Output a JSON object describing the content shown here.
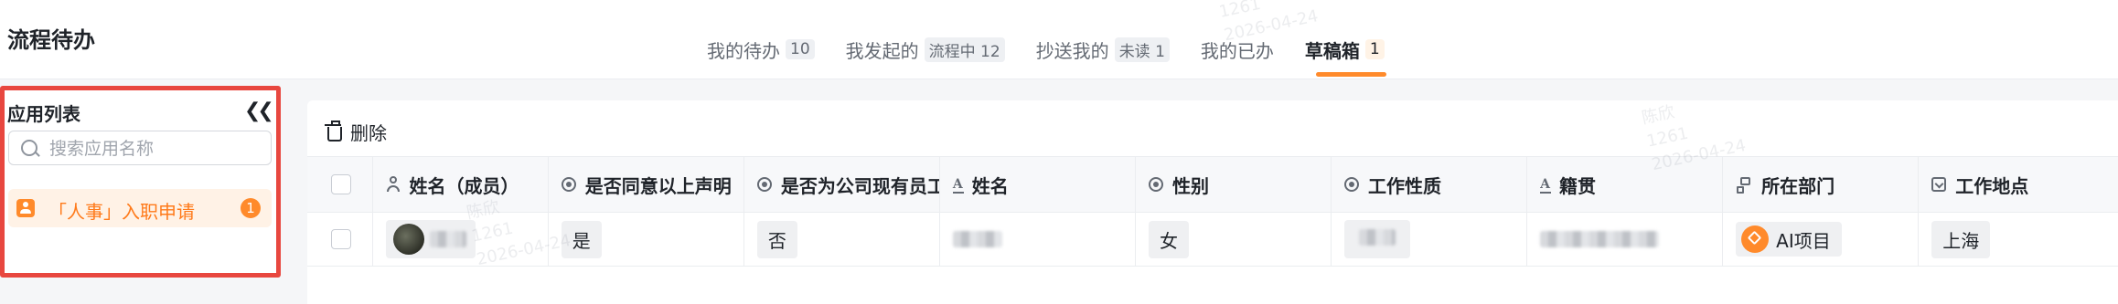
{
  "header": {
    "title": "流程待办",
    "tabs": [
      {
        "label": "我的待办",
        "count": "10"
      },
      {
        "label": "我发起的",
        "count": "流程中 12"
      },
      {
        "label": "抄送我的",
        "count": "未读 1"
      },
      {
        "label": "我的已办",
        "count": ""
      },
      {
        "label": "草稿箱",
        "count": "1"
      }
    ],
    "active_tab": "草稿箱",
    "accent_color": "#ff8a2b"
  },
  "sidebar": {
    "title": "应用列表",
    "collapse_icon": "double-chevron-left-icon",
    "search_placeholder": "搜索应用名称",
    "items": [
      {
        "label": "「人事」入职申请",
        "badge": "1"
      }
    ],
    "highlight_color": "#e8473f"
  },
  "toolbar": {
    "delete_label": "删除"
  },
  "table": {
    "columns": [
      {
        "label": "姓名（成员）",
        "icon": "person-icon"
      },
      {
        "label": "是否同意以上声明",
        "icon": "radio-icon"
      },
      {
        "label": "是否为公司现有员工",
        "icon": "radio-icon"
      },
      {
        "label": "姓名",
        "icon": "text-icon"
      },
      {
        "label": "性别",
        "icon": "radio-icon"
      },
      {
        "label": "工作性质",
        "icon": "radio-icon"
      },
      {
        "label": "籍贯",
        "icon": "text-icon"
      },
      {
        "label": "所在部门",
        "icon": "org-icon"
      },
      {
        "label": "工作地点",
        "icon": "select-icon"
      }
    ],
    "rows": [
      {
        "member": "",
        "agree": "是",
        "existing": "否",
        "name": "",
        "gender": "女",
        "work_type": "",
        "origin": "",
        "department": "AI项目",
        "location": "上海"
      }
    ]
  },
  "watermark": {
    "name": "陈欣",
    "id": "1261",
    "date": "2026-04-24"
  }
}
